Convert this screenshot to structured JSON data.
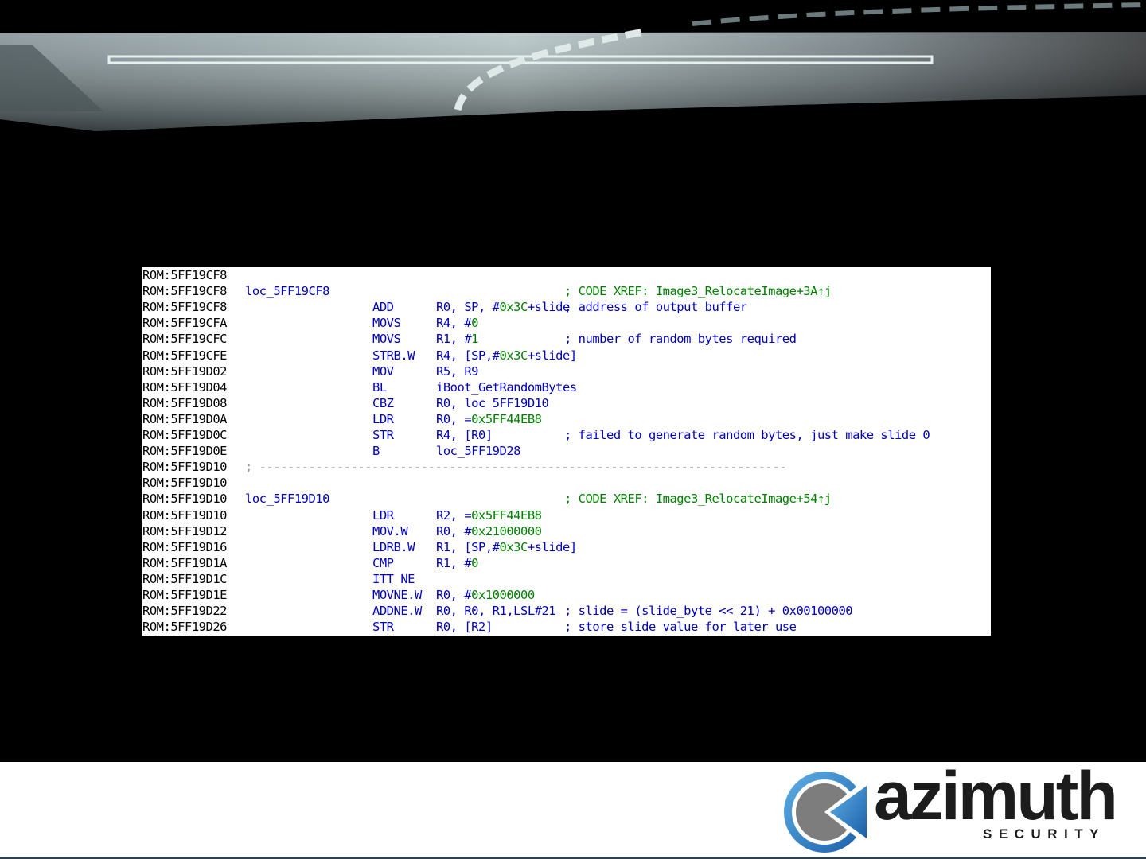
{
  "code_lines": [
    {
      "addr": "ROM:5FF19CF8",
      "label": "",
      "mnemonic": "",
      "operands": [],
      "comment": ""
    },
    {
      "addr": "ROM:5FF19CF8",
      "label": "loc_5FF19CF8",
      "mnemonic": "",
      "operands": [],
      "comment": "; CODE XREF: Image3_RelocateImage+3A↑j",
      "comment_color": "green"
    },
    {
      "addr": "ROM:5FF19CF8",
      "label": "",
      "mnemonic": "ADD",
      "operands": [
        {
          "t": "R0, SP, #",
          "c": "blue"
        },
        {
          "t": "0x3C",
          "c": "green"
        },
        {
          "t": "+slide",
          "c": "blue"
        }
      ],
      "comment": "; address of output buffer"
    },
    {
      "addr": "ROM:5FF19CFA",
      "label": "",
      "mnemonic": "MOVS",
      "operands": [
        {
          "t": "R4, #",
          "c": "blue"
        },
        {
          "t": "0",
          "c": "green"
        }
      ],
      "comment": ""
    },
    {
      "addr": "ROM:5FF19CFC",
      "label": "",
      "mnemonic": "MOVS",
      "operands": [
        {
          "t": "R1, #",
          "c": "blue"
        },
        {
          "t": "1",
          "c": "green"
        }
      ],
      "comment": "; number of random bytes required"
    },
    {
      "addr": "ROM:5FF19CFE",
      "label": "",
      "mnemonic": "STRB.W",
      "operands": [
        {
          "t": "R4, [SP,#",
          "c": "blue"
        },
        {
          "t": "0x3C",
          "c": "green"
        },
        {
          "t": "+slide]",
          "c": "blue"
        }
      ],
      "comment": ""
    },
    {
      "addr": "ROM:5FF19D02",
      "label": "",
      "mnemonic": "MOV",
      "operands": [
        {
          "t": "R5, R9",
          "c": "blue"
        }
      ],
      "comment": ""
    },
    {
      "addr": "ROM:5FF19D04",
      "label": "",
      "mnemonic": "BL",
      "operands": [
        {
          "t": "iBoot_GetRandomBytes",
          "c": "blue"
        }
      ],
      "comment": ""
    },
    {
      "addr": "ROM:5FF19D08",
      "label": "",
      "mnemonic": "CBZ",
      "operands": [
        {
          "t": "R0, loc_5FF19D10",
          "c": "blue"
        }
      ],
      "comment": ""
    },
    {
      "addr": "ROM:5FF19D0A",
      "label": "",
      "mnemonic": "LDR",
      "operands": [
        {
          "t": "R0, =",
          "c": "blue"
        },
        {
          "t": "0x5FF44EB8",
          "c": "green"
        }
      ],
      "comment": ""
    },
    {
      "addr": "ROM:5FF19D0C",
      "label": "",
      "mnemonic": "STR",
      "operands": [
        {
          "t": "R4, [R0]",
          "c": "blue"
        }
      ],
      "comment": "; failed to generate random bytes, just make slide 0"
    },
    {
      "addr": "ROM:5FF19D0E",
      "label": "",
      "mnemonic": "B",
      "operands": [
        {
          "t": "loc_5FF19D28",
          "c": "blue"
        }
      ],
      "comment": ""
    },
    {
      "addr": "ROM:5FF19D10",
      "label": "",
      "mnemonic": "",
      "operands": [],
      "comment": "",
      "separator": "; ---------------------------------------------------------------------------"
    },
    {
      "addr": "ROM:5FF19D10",
      "label": "",
      "mnemonic": "",
      "operands": [],
      "comment": ""
    },
    {
      "addr": "ROM:5FF19D10",
      "label": "loc_5FF19D10",
      "mnemonic": "",
      "operands": [],
      "comment": "; CODE XREF: Image3_RelocateImage+54↑j",
      "comment_color": "green"
    },
    {
      "addr": "ROM:5FF19D10",
      "label": "",
      "mnemonic": "LDR",
      "operands": [
        {
          "t": "R2, =",
          "c": "blue"
        },
        {
          "t": "0x5FF44EB8",
          "c": "green"
        }
      ],
      "comment": ""
    },
    {
      "addr": "ROM:5FF19D12",
      "label": "",
      "mnemonic": "MOV.W",
      "operands": [
        {
          "t": "R0, #",
          "c": "blue"
        },
        {
          "t": "0x21000000",
          "c": "green"
        }
      ],
      "comment": ""
    },
    {
      "addr": "ROM:5FF19D16",
      "label": "",
      "mnemonic": "LDRB.W",
      "operands": [
        {
          "t": "R1, [SP,#",
          "c": "blue"
        },
        {
          "t": "0x3C",
          "c": "green"
        },
        {
          "t": "+slide]",
          "c": "blue"
        }
      ],
      "comment": ""
    },
    {
      "addr": "ROM:5FF19D1A",
      "label": "",
      "mnemonic": "CMP",
      "operands": [
        {
          "t": "R1, #",
          "c": "blue"
        },
        {
          "t": "0",
          "c": "green"
        }
      ],
      "comment": ""
    },
    {
      "addr": "ROM:5FF19D1C",
      "label": "",
      "mnemonic": "ITT NE",
      "operands": [],
      "comment": ""
    },
    {
      "addr": "ROM:5FF19D1E",
      "label": "",
      "mnemonic": "MOVNE.W",
      "operands": [
        {
          "t": "R0, #",
          "c": "blue"
        },
        {
          "t": "0x1000000",
          "c": "green"
        }
      ],
      "comment": ""
    },
    {
      "addr": "ROM:5FF19D22",
      "label": "",
      "mnemonic": "ADDNE.W",
      "operands": [
        {
          "t": "R0, R0, R1,LSL#21",
          "c": "blue"
        }
      ],
      "comment": "; slide = (slide_byte << 21) + 0x00100000"
    },
    {
      "addr": "ROM:5FF19D26",
      "label": "",
      "mnemonic": "STR",
      "operands": [
        {
          "t": "R0, [R2]",
          "c": "blue"
        }
      ],
      "comment": "; store slide value for later use"
    }
  ],
  "logo": {
    "word": "azimuth",
    "sub": "SECURITY",
    "icon": "azimuth-compass-icon"
  },
  "colors": {
    "code_blue": "#0000c0",
    "code_green": "#008000",
    "footer_line": "#2c3f4f"
  }
}
